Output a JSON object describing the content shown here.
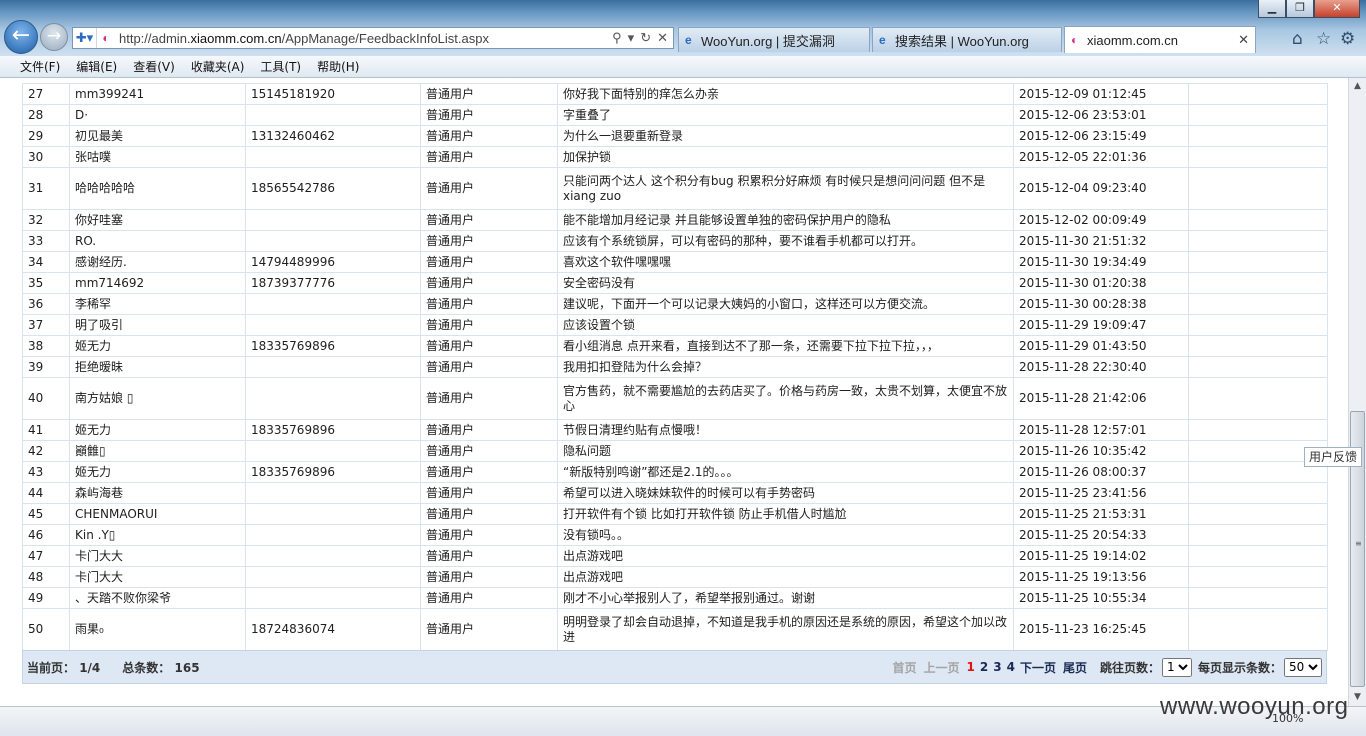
{
  "browser": {
    "url_prefix": "http://admin.",
    "url_domain": "xiaomm.com.cn",
    "url_path": "/AppManage/FeedbackInfoList.aspx",
    "tabs": [
      {
        "label": "WooYun.org | 提交漏洞",
        "icon": "ie-icon"
      },
      {
        "label": "搜索结果 | WooYun.org",
        "icon": "ie-icon"
      },
      {
        "label": "xiaomm.com.cn",
        "icon": "site-favicon",
        "active": true
      }
    ],
    "close_glyph": "✕",
    "menu": [
      "文件(F)",
      "编辑(E)",
      "查看(V)",
      "收藏夹(A)",
      "工具(T)",
      "帮助(H)"
    ],
    "zoom": "100%"
  },
  "rows": [
    {
      "id": "27",
      "user": "mm399241",
      "phone": "15145181920",
      "type": "普通用户",
      "content": "你好我下面特别的痒怎么办亲",
      "time": "2015-12-09 01:12:45"
    },
    {
      "id": "28",
      "user": "D·",
      "phone": "",
      "type": "普通用户",
      "content": "字重叠了",
      "time": "2015-12-06 23:53:01"
    },
    {
      "id": "29",
      "user": "初见最美",
      "phone": "13132460462",
      "type": "普通用户",
      "content": "为什么一退要重新登录",
      "time": "2015-12-06 23:15:49"
    },
    {
      "id": "30",
      "user": "张咕噗",
      "phone": "",
      "type": "普通用户",
      "content": "加保护锁",
      "time": "2015-12-05 22:01:36"
    },
    {
      "id": "31",
      "user": "哈哈哈哈哈",
      "phone": "18565542786",
      "type": "普通用户",
      "content": "只能问两个达人 这个积分有bug 积累积分好麻烦 有时候只是想问问问题 但不是xiang zuo",
      "time": "2015-12-04 09:23:40",
      "tall": true
    },
    {
      "id": "32",
      "user": "你好哇塞",
      "phone": "",
      "type": "普通用户",
      "content": "能不能增加月经记录 并且能够设置单独的密码保护用户的隐私",
      "time": "2015-12-02 00:09:49"
    },
    {
      "id": "33",
      "user": "RO.",
      "phone": "",
      "type": "普通用户",
      "content": "应该有个系统锁屏，可以有密码的那种，要不谁看手机都可以打开。",
      "time": "2015-11-30 21:51:32"
    },
    {
      "id": "34",
      "user": "感谢经历.",
      "phone": "14794489996",
      "type": "普通用户",
      "content": "喜欢这个软件嘿嘿嘿",
      "time": "2015-11-30 19:34:49"
    },
    {
      "id": "35",
      "user": "mm714692",
      "phone": "18739377776",
      "type": "普通用户",
      "content": "安全密码没有",
      "time": "2015-11-30 01:20:38"
    },
    {
      "id": "36",
      "user": "李稀罕",
      "phone": "",
      "type": "普通用户",
      "content": "建议呢，下面开一个可以记录大姨妈的小窗口，这样还可以方便交流。",
      "time": "2015-11-30 00:28:38"
    },
    {
      "id": "37",
      "user": "明了吸引",
      "phone": "",
      "type": "普通用户",
      "content": "应该设置个锁",
      "time": "2015-11-29 19:09:47"
    },
    {
      "id": "38",
      "user": "姬无力",
      "phone": "18335769896",
      "type": "普通用户",
      "content": "看小组消息 点开来看，直接到达不了那一条，还需要下拉下拉下拉，，，",
      "time": "2015-11-29 01:43:50"
    },
    {
      "id": "39",
      "user": "拒绝暧昧",
      "phone": "",
      "type": "普通用户",
      "content": "我用扣扣登陆为什么会掉？",
      "time": "2015-11-28 22:30:40"
    },
    {
      "id": "40",
      "user": "南方姑娘 ▯",
      "phone": "",
      "type": "普通用户",
      "content": "官方售药，就不需要尴尬的去药店买了。价格与药房一致，太贵不划算，太便宜不放心",
      "time": "2015-11-28 21:42:06",
      "tall": true
    },
    {
      "id": "41",
      "user": "姬无力",
      "phone": "18335769896",
      "type": "普通用户",
      "content": "节假日清理约贴有点慢哦！",
      "time": "2015-11-28 12:57:01"
    },
    {
      "id": "42",
      "user": "巓雔▯",
      "phone": "",
      "type": "普通用户",
      "content": "隐私问题",
      "time": "2015-11-26 10:35:42"
    },
    {
      "id": "43",
      "user": "姬无力",
      "phone": "18335769896",
      "type": "普通用户",
      "content": "“新版特别鸣谢”都还是2.1的。。。",
      "time": "2015-11-26 08:00:37"
    },
    {
      "id": "44",
      "user": "森屿海巷",
      "phone": "",
      "type": "普通用户",
      "content": "希望可以进入晓妹妹软件的时候可以有手势密码",
      "time": "2015-11-25 23:41:56"
    },
    {
      "id": "45",
      "user": "CHENMAORUI",
      "phone": "",
      "type": "普通用户",
      "content": "打开软件有个锁 比如打开软件锁 防止手机借人时尴尬",
      "time": "2015-11-25 21:53:31"
    },
    {
      "id": "46",
      "user": "Kin .Y▯",
      "phone": "",
      "type": "普通用户",
      "content": "没有锁吗。。",
      "time": "2015-11-25 20:54:33"
    },
    {
      "id": "47",
      "user": "卡门大大",
      "phone": "",
      "type": "普通用户",
      "content": "出点游戏吧",
      "time": "2015-11-25 19:14:02"
    },
    {
      "id": "48",
      "user": "卡门大大",
      "phone": "",
      "type": "普通用户",
      "content": "出点游戏吧",
      "time": "2015-11-25 19:13:56"
    },
    {
      "id": "49",
      "user": "、天踏不败你梁爷",
      "phone": "",
      "type": "普通用户",
      "content": "刚才不小心举报别人了，希望举报别通过。谢谢",
      "time": "2015-11-25 10:55:34"
    },
    {
      "id": "50",
      "user": "雨果₀",
      "phone": "18724836074",
      "type": "普通用户",
      "content": "明明登录了却会自动退掉，不知道是我手机的原因还是系统的原因，希望这个加以改进",
      "time": "2015-11-23 16:25:45",
      "tall": true
    }
  ],
  "pager": {
    "current_label": "当前页：",
    "current_value": "1/4",
    "total_label": "总条数：",
    "total_value": "165",
    "first": "首页",
    "prev": "上一页",
    "pages": [
      "1",
      "2",
      "3",
      "4"
    ],
    "current_page": "1",
    "next": "下一页",
    "last": "尾页",
    "jump_label": "跳往页数：",
    "jump_value": "1",
    "size_label": "每页显示条数：",
    "size_value": "50"
  },
  "side_tab": "用户反馈",
  "watermark": "www.wooyun.org"
}
